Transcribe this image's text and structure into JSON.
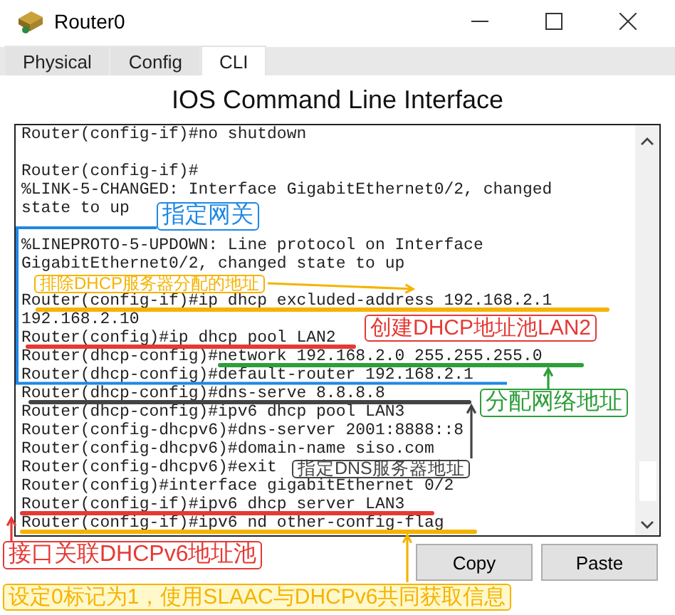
{
  "window": {
    "title": "Router0"
  },
  "tabs": [
    {
      "label": "Physical",
      "selected": false
    },
    {
      "label": "Config",
      "selected": false
    },
    {
      "label": "CLI",
      "selected": true
    }
  ],
  "heading": "IOS Command Line Interface",
  "terminal": {
    "blocks": [
      [
        "Router(config-if)#no shutdown"
      ],
      [
        "Router(config-if)#",
        "%LINK-5-CHANGED: Interface GigabitEthernet0/2, changed",
        "state to up"
      ],
      [
        "%LINEPROTO-5-UPDOWN: Line protocol on Interface",
        "GigabitEthernet0/2, changed state to up"
      ],
      [
        "Router(config-if)#ip dhcp excluded-address 192.168.2.1",
        "192.168.2.10",
        "Router(config)#ip dhcp pool LAN2",
        "Router(dhcp-config)#network 192.168.2.0 255.255.255.0",
        "Router(dhcp-config)#default-router 192.168.2.1",
        "Router(dhcp-config)#dns-serve 8.8.8.8",
        "Router(dhcp-config)#ipv6 dhcp pool LAN3",
        "Router(config-dhcpv6)#dns-server 2001:8888::8",
        "Router(config-dhcpv6)#domain-name siso.com",
        "Router(config-dhcpv6)#exit",
        "Router(config)#interface gigabitEthernet 0/2",
        "Router(config-if)#ipv6 dhcp server LAN3",
        "Router(config-if)#ipv6 nd other-config-flag"
      ]
    ]
  },
  "buttons": [
    "Copy",
    "Paste"
  ],
  "annotations": [
    {
      "label": "指定网关",
      "color": "#1e88e5"
    },
    {
      "label": "排除DHCP服务器分配的地址",
      "color": "#f5b300"
    },
    {
      "label": "创建DHCP地址池LAN2",
      "color": "#e53935"
    },
    {
      "label": "分配网络地址",
      "color": "#2e9e3a"
    },
    {
      "label": "指定DNS服务器地址",
      "color": "#444444"
    },
    {
      "label": "接口关联DHCPv6地址池",
      "color": "#e53935"
    },
    {
      "label": "设定0标记为1，使用SLAAC与DHCPv6共同获取信息",
      "color": "#f5b300"
    }
  ]
}
